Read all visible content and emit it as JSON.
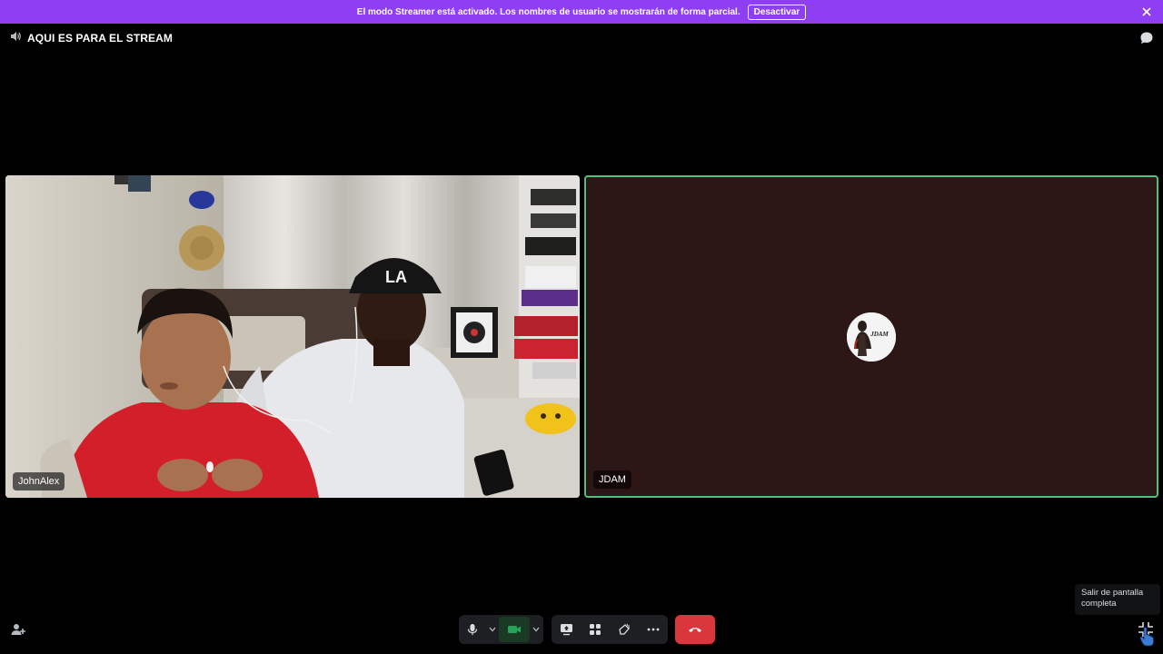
{
  "banner": {
    "message": "El modo Streamer está activado. Los nombres de usuario se mostrarán de forma parcial.",
    "button_label": "Desactivar"
  },
  "channel": {
    "name": "AQUI ES PARA EL STREAM"
  },
  "participants": [
    {
      "name": "JohnAlex",
      "video": true
    },
    {
      "name": "JDAM",
      "video": false,
      "speaking": true
    }
  ],
  "avatar_text": "JDAM",
  "tooltip": {
    "text": "Salir de pantalla completa"
  },
  "colors": {
    "banner": "#8e3ff2",
    "speaking_border": "#4fbf7a",
    "hangup": "#da373c",
    "camera_active": "#23a55a"
  },
  "icons": [
    "speaker-icon",
    "chat-icon",
    "close-icon",
    "microphone-icon",
    "chevron-down-icon",
    "camera-icon",
    "share-screen-icon",
    "activities-icon",
    "soundboard-icon",
    "more-icon",
    "hang-up-icon",
    "invite-icon",
    "exit-fullscreen-icon"
  ]
}
